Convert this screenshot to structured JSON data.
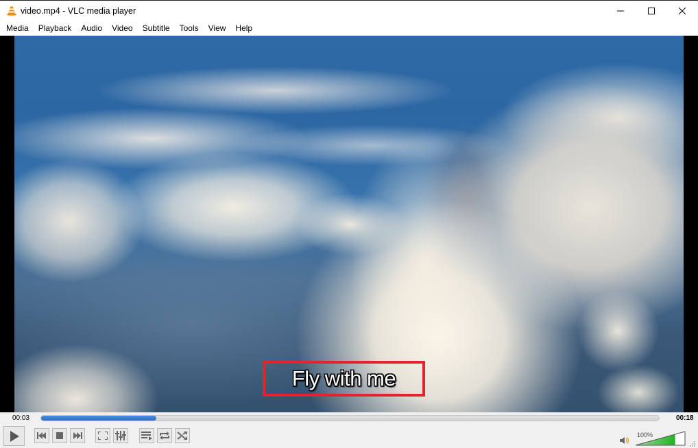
{
  "window": {
    "title": "video.mp4 - VLC media player",
    "app_icon": "vlc-cone-icon",
    "buttons": {
      "minimize": "minimize-icon",
      "maximize": "maximize-icon",
      "close": "close-icon"
    }
  },
  "menubar": {
    "items": [
      {
        "label": "Media"
      },
      {
        "label": "Playback"
      },
      {
        "label": "Audio"
      },
      {
        "label": "Video"
      },
      {
        "label": "Subtitle"
      },
      {
        "label": "Tools"
      },
      {
        "label": "View"
      },
      {
        "label": "Help"
      }
    ]
  },
  "video": {
    "content": "aerial view of clouds over landscape",
    "subtitle": "Fly with me",
    "subtitle_highlight_color": "#e3232d"
  },
  "seekbar": {
    "elapsed": "00:03",
    "total": "00:18",
    "progress_fraction": 0.187,
    "fill_color": "#3a7fd0"
  },
  "controls": {
    "buttons": [
      {
        "name": "play",
        "icon": "play-icon"
      },
      {
        "name": "previous",
        "icon": "skip-previous-icon"
      },
      {
        "name": "stop",
        "icon": "stop-icon"
      },
      {
        "name": "next",
        "icon": "skip-next-icon"
      },
      {
        "name": "fullscreen",
        "icon": "fullscreen-icon"
      },
      {
        "name": "extended-settings",
        "icon": "equalizer-icon"
      },
      {
        "name": "playlist",
        "icon": "playlist-icon"
      },
      {
        "name": "loop",
        "icon": "loop-icon"
      },
      {
        "name": "shuffle",
        "icon": "shuffle-icon"
      }
    ]
  },
  "volume": {
    "label": "100%",
    "level_percent": 100,
    "icon": "speaker-icon",
    "fill_color": "#2ebd2e"
  }
}
